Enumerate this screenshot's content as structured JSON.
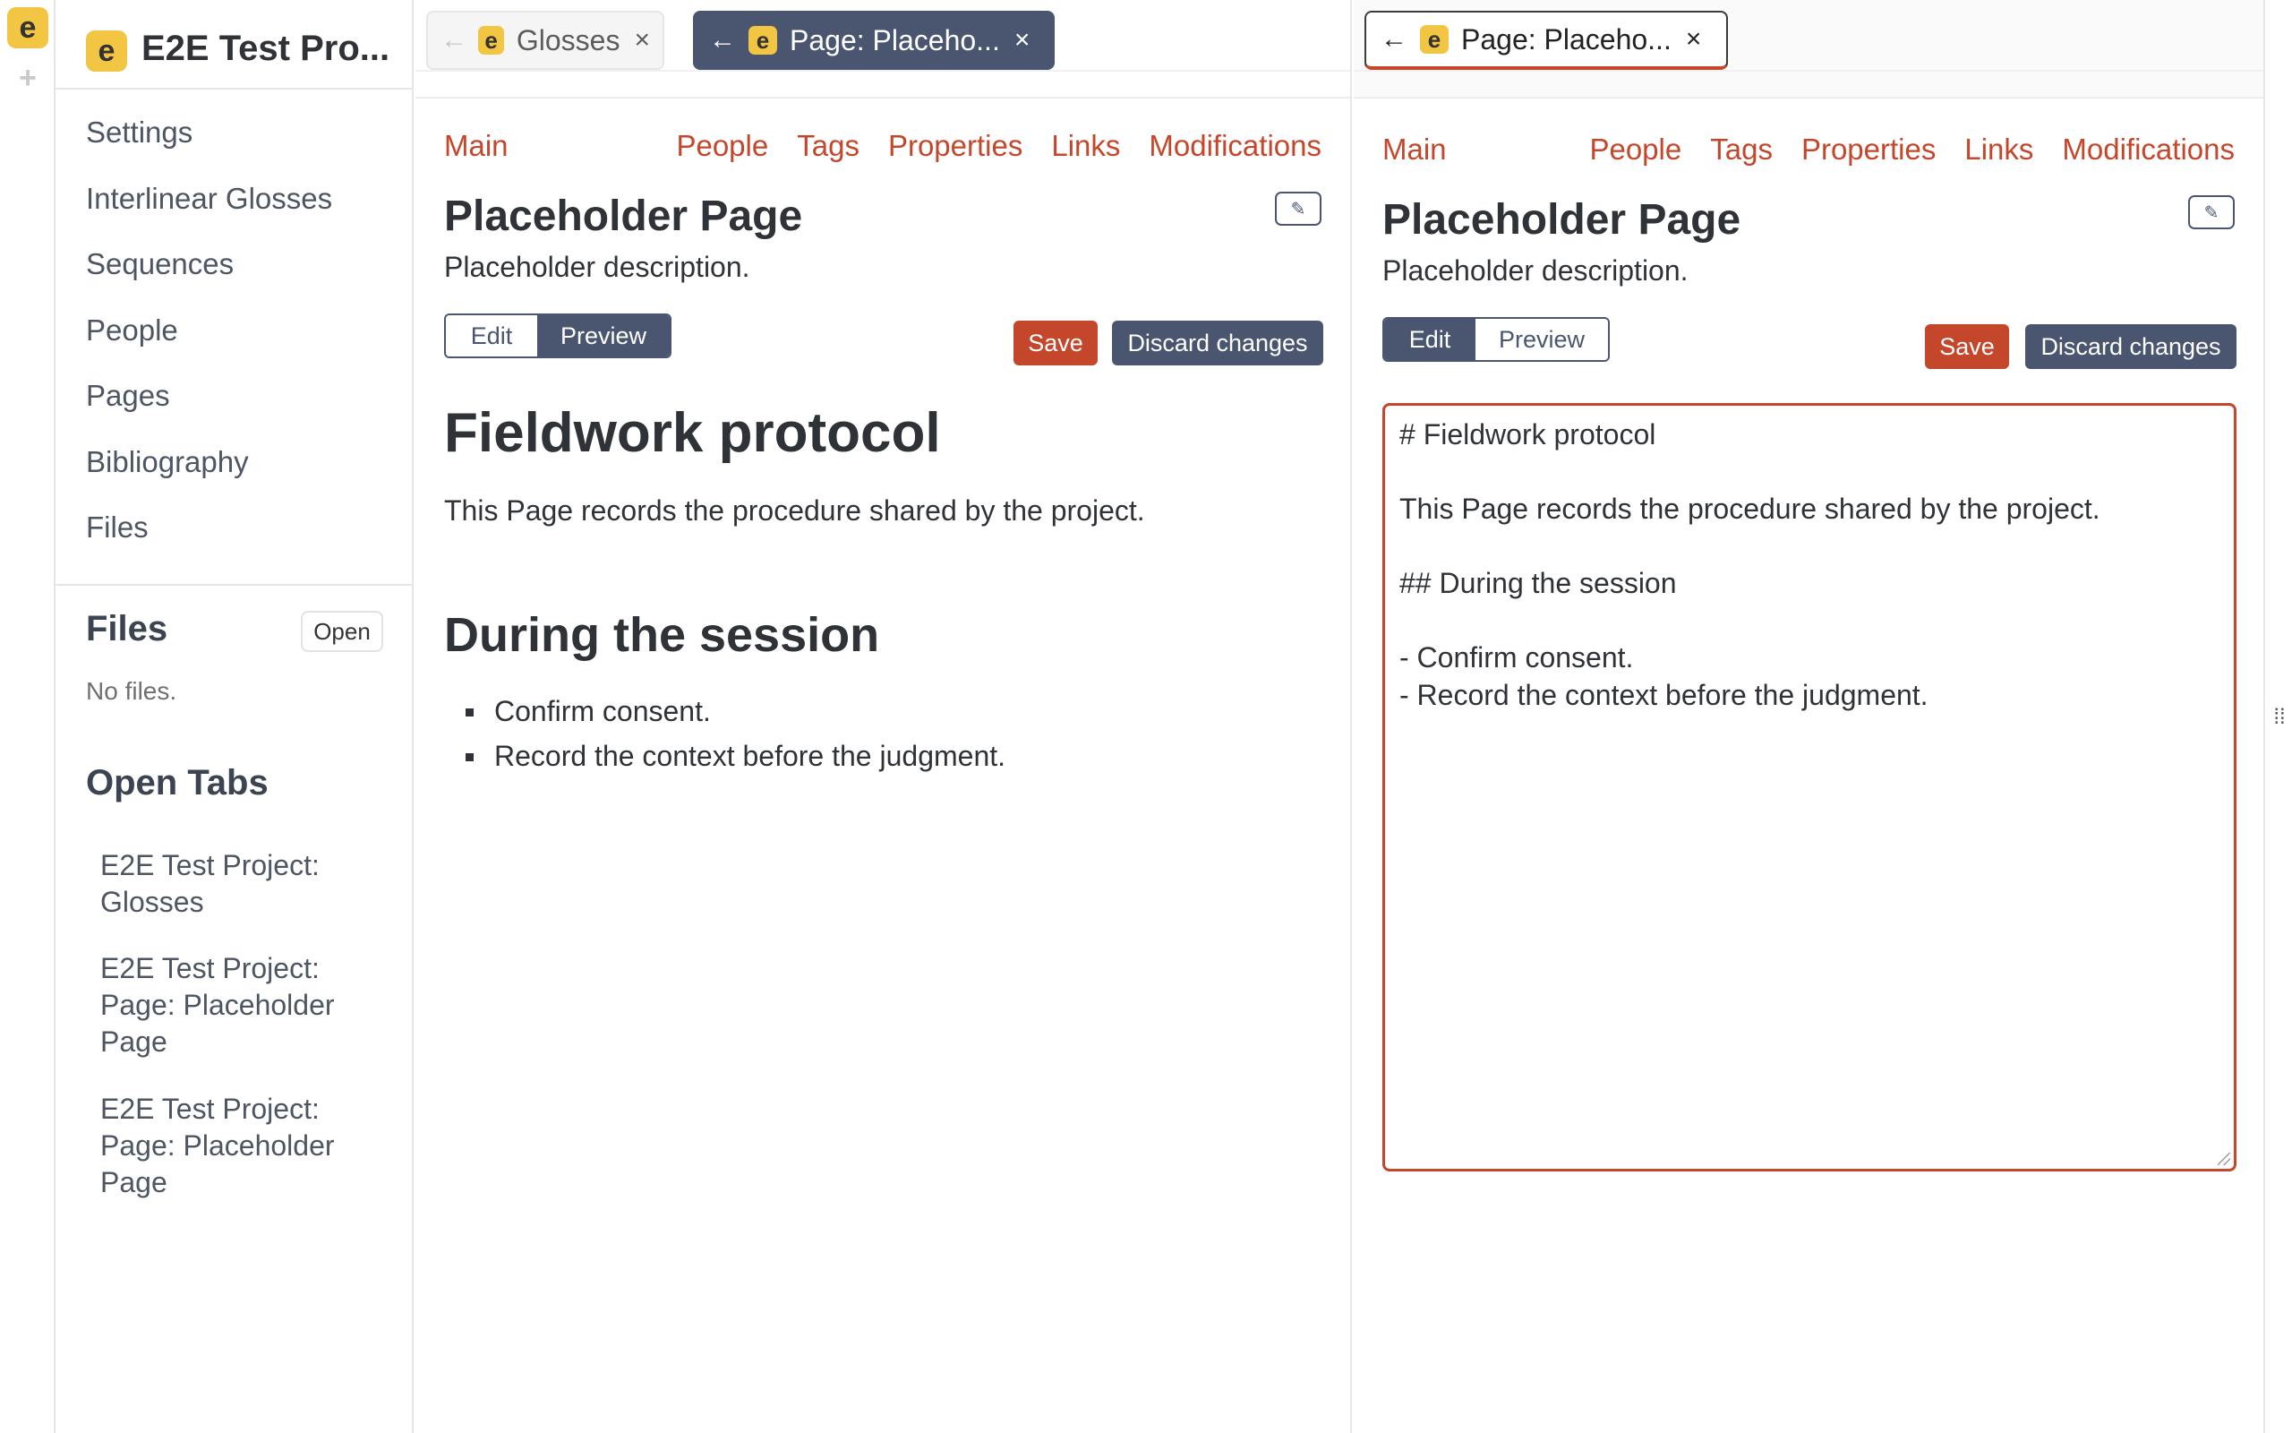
{
  "rail": {
    "logo_letter": "e",
    "add_glyph": "+"
  },
  "project": {
    "logo_letter": "e",
    "title": "E2E Test Pro..."
  },
  "nav": [
    "Settings",
    "Interlinear Glosses",
    "Sequences",
    "People",
    "Pages",
    "Bibliography",
    "Files"
  ],
  "files": {
    "heading": "Files",
    "open_label": "Open",
    "empty": "No files."
  },
  "open_tabs": {
    "heading": "Open Tabs",
    "items": [
      "E2E Test Project: Glosses",
      "E2E Test Project: Page: Placeholder Page",
      "E2E Test Project: Page: Placeholder Page"
    ]
  },
  "left_pane": {
    "tabs": [
      {
        "label": "Glosses",
        "logo": "e"
      },
      {
        "label": "Page: Placeho...",
        "logo": "e"
      }
    ],
    "nav": {
      "main": "Main",
      "links": [
        "People",
        "Tags",
        "Properties",
        "Links",
        "Modifications"
      ]
    },
    "title": "Placeholder Page",
    "description": "Placeholder description.",
    "mode": {
      "edit": "Edit",
      "preview": "Preview"
    },
    "save": "Save",
    "discard": "Discard changes",
    "preview": {
      "h1": "Fieldwork protocol",
      "para": "This Page records the procedure shared by the project.",
      "h2": "During the session",
      "items": [
        "Confirm consent.",
        "Record the context before the judgment."
      ]
    }
  },
  "right_pane": {
    "tab": {
      "label": "Page: Placeho...",
      "logo": "e"
    },
    "nav": {
      "main": "Main",
      "links": [
        "People",
        "Tags",
        "Properties",
        "Links",
        "Modifications"
      ]
    },
    "title": "Placeholder Page",
    "description": "Placeholder description.",
    "mode": {
      "edit": "Edit",
      "preview": "Preview"
    },
    "save": "Save",
    "discard": "Discard changes",
    "editor_lines": [
      "# Fieldwork protocol",
      "",
      "This Page records the procedure shared by the project.",
      "",
      "## During the session",
      "",
      "- Confirm consent.",
      "- Record the context before the judgment."
    ]
  },
  "glyphs": {
    "back": "←",
    "close": "×",
    "pencil": "✎",
    "grip": "⁞⁞"
  },
  "colors": {
    "accent": "#c4472b",
    "slate": "#4a5670",
    "logo": "#f2c542"
  }
}
